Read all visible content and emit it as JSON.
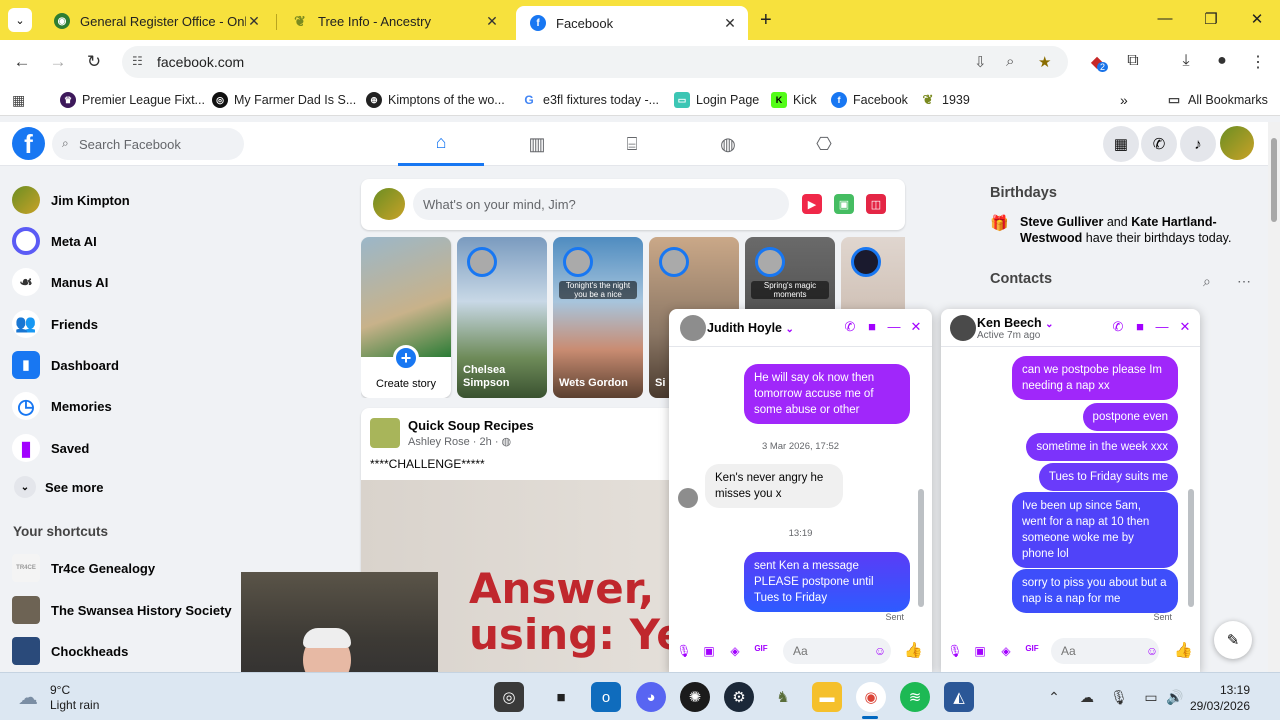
{
  "browser": {
    "tabs": [
      {
        "label": "General Register Office - Online",
        "icon": "gro-globe-icon"
      },
      {
        "label": "Tree Info - Ancestry",
        "icon": "ancestry-leaf-icon"
      },
      {
        "label": "Facebook",
        "icon": "facebook-icon",
        "active": true
      }
    ],
    "url": "facebook.com",
    "extension_badge": "2",
    "bookmarks": [
      {
        "label": "Premier League Fixt..."
      },
      {
        "label": "My Farmer Dad Is S..."
      },
      {
        "label": "Kimptons of the wo..."
      },
      {
        "label": "e3fl fixtures today -..."
      },
      {
        "label": "Login Page"
      },
      {
        "label": "Kick"
      },
      {
        "label": "Facebook"
      },
      {
        "label": "1939"
      }
    ],
    "all_bookmarks": "All Bookmarks"
  },
  "fb": {
    "search_placeholder": "Search Facebook",
    "composer_placeholder": "What's on your mind, Jim?",
    "sidebar": [
      {
        "label": "Jim Kimpton"
      },
      {
        "label": "Meta AI"
      },
      {
        "label": "Manus AI"
      },
      {
        "label": "Friends"
      },
      {
        "label": "Dashboard"
      },
      {
        "label": "Memories"
      },
      {
        "label": "Saved"
      },
      {
        "label": "See more"
      }
    ],
    "shortcuts_title": "Your shortcuts",
    "shortcuts": [
      {
        "label": "Tr4ce Genealogy"
      },
      {
        "label": "The Swansea History Society"
      },
      {
        "label": "Chockheads"
      }
    ],
    "stories": {
      "create_label": "Create story",
      "items": [
        {
          "name": "Chelsea Simpson",
          "caption": ""
        },
        {
          "name": "Wets Gordon",
          "caption": "Tonight's the night you be a nice"
        },
        {
          "name": "Si",
          "caption": ""
        },
        {
          "name": "",
          "caption": "Spring's magic moments"
        },
        {
          "name": "",
          "caption": ""
        }
      ]
    },
    "post": {
      "title": "Quick Soup Recipes",
      "meta": "Ashley Rose · 2h · ",
      "text": "****CHALLENGE*****",
      "image_text_line1": "Answer, w",
      "image_text_line2": "using: Yes"
    },
    "right_rail": {
      "birthdays_title": "Birthdays",
      "birthday_name1": "Steve Gulliver",
      "birthday_and": " and ",
      "birthday_name2": "Kate Hartland-Westwood",
      "birthday_suffix": " have their birthdays today.",
      "contacts_title": "Contacts"
    }
  },
  "chats": [
    {
      "name": "Judith Hoyle",
      "status": "",
      "messages": [
        {
          "type": "sent",
          "text": "He will say ok now then tomorrow accuse me of some abuse or other"
        },
        {
          "type": "time",
          "text": "3 Mar 2026, 17:52"
        },
        {
          "type": "recv",
          "text": "Ken's never  angry  he misses you x"
        },
        {
          "type": "time",
          "text": "13:19"
        },
        {
          "type": "sent",
          "text": "sent Ken a message PLEASE postpone until Tues to Friday"
        }
      ],
      "sent_label": "Sent",
      "input_placeholder": "Aa"
    },
    {
      "name": "Ken Beech",
      "status": "Active 7m ago",
      "messages": [
        {
          "type": "sent",
          "text": "can we postpobe please Im needing a nap xx"
        },
        {
          "type": "sent",
          "text": "postpone even"
        },
        {
          "type": "sent",
          "text": "sometime in the week xxx"
        },
        {
          "type": "sent",
          "text": "Tues to Friday suits me"
        },
        {
          "type": "sent",
          "text": "Ive been up since 5am, went for a nap at 10 then someone woke me by phone lol"
        },
        {
          "type": "sent",
          "text": "sorry to piss you about but a nap is a nap for me"
        }
      ],
      "sent_label": "Sent",
      "input_placeholder": "Aa"
    }
  ],
  "taskbar": {
    "temperature": "9°C",
    "weather": "Light rain",
    "time": "13:19",
    "date": "29/03/2026"
  },
  "colors": {
    "chrome_tabstrip": "#f7e13d",
    "facebook_blue": "#1877f2",
    "messenger_gradient_top": "#a033ff",
    "messenger_gradient_bottom": "#2e5bff"
  }
}
